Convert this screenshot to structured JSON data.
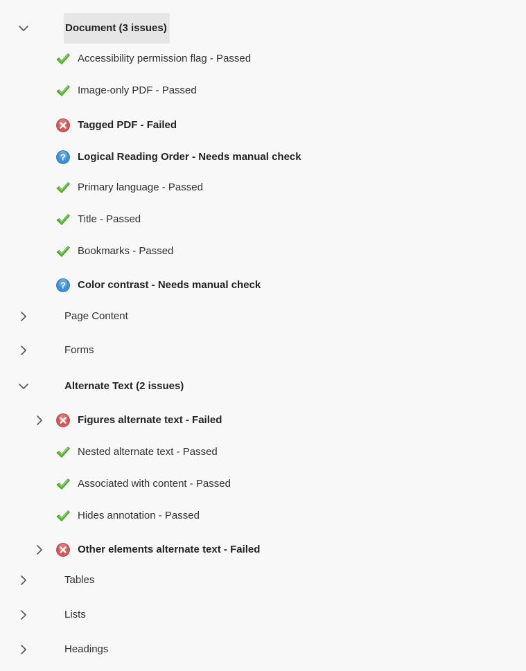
{
  "panel": {
    "categories": [
      {
        "label": "Document (3 issues)",
        "expanded": true,
        "items": [
          {
            "label": "Accessibility permission flag - Passed",
            "status": "passed"
          },
          {
            "label": "Image-only PDF - Passed",
            "status": "passed"
          },
          {
            "label": "Tagged PDF - Failed",
            "status": "failed"
          },
          {
            "label": "Logical Reading Order - Needs manual check",
            "status": "manual"
          },
          {
            "label": "Primary language - Passed",
            "status": "passed"
          },
          {
            "label": "Title - Passed",
            "status": "passed"
          },
          {
            "label": "Bookmarks - Passed",
            "status": "passed"
          },
          {
            "label": "Color contrast - Needs manual check",
            "status": "manual"
          }
        ]
      },
      {
        "label": "Page Content",
        "expanded": false,
        "items": []
      },
      {
        "label": "Forms",
        "expanded": false,
        "items": []
      },
      {
        "label": "Alternate Text (2 issues)",
        "expanded": true,
        "items": [
          {
            "label": "Figures alternate text - Failed",
            "status": "failed",
            "expandable": true
          },
          {
            "label": "Nested alternate text - Passed",
            "status": "passed"
          },
          {
            "label": "Associated with content - Passed",
            "status": "passed"
          },
          {
            "label": "Hides annotation - Passed",
            "status": "passed"
          },
          {
            "label": "Other elements alternate text - Failed",
            "status": "failed",
            "expandable": true
          }
        ]
      },
      {
        "label": "Tables",
        "expanded": false,
        "items": []
      },
      {
        "label": "Lists",
        "expanded": false,
        "items": []
      },
      {
        "label": "Headings",
        "expanded": false,
        "items": []
      }
    ]
  },
  "icons": {
    "passed": "checkmark-icon",
    "failed": "error-x-icon",
    "manual": "question-icon",
    "expanded": "chevron-down-icon",
    "collapsed": "chevron-right-icon"
  },
  "colors": {
    "background": "#f8f8f8",
    "selected": "#e6e6e6",
    "passed": "#5cb833",
    "failed": "#d45858",
    "manual": "#3d8fd6"
  }
}
